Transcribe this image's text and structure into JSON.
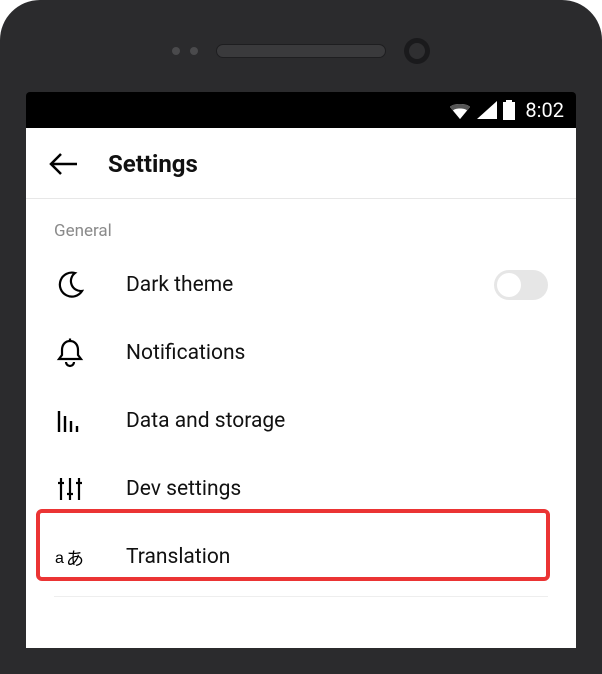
{
  "status": {
    "time": "8:02"
  },
  "header": {
    "title": "Settings"
  },
  "section": {
    "label": "General"
  },
  "rows": {
    "dark_theme": {
      "label": "Dark theme",
      "toggle_on": false
    },
    "notifications": {
      "label": "Notifications"
    },
    "data_storage": {
      "label": "Data and storage"
    },
    "dev_settings": {
      "label": "Dev settings"
    },
    "translation": {
      "label": "Translation"
    }
  }
}
